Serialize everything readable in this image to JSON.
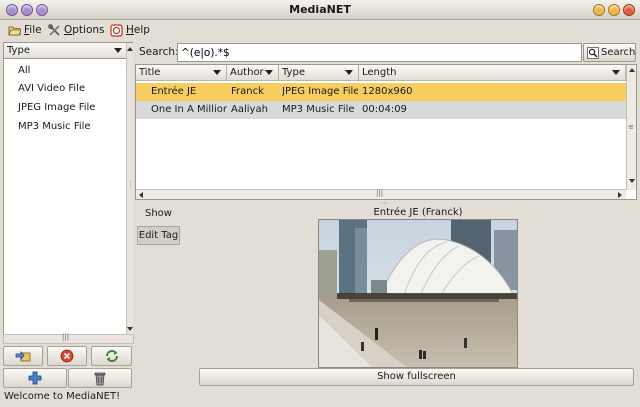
{
  "window": {
    "title": "MediaNET"
  },
  "menu": [
    {
      "label": "File",
      "icon": "open-folder-icon"
    },
    {
      "label": "Options",
      "icon": "tools-icon"
    },
    {
      "label": "Help",
      "icon": "help-icon"
    }
  ],
  "type_filter": {
    "selected": "Type",
    "items": [
      "All",
      "AVI Video File",
      "JPEG Image File",
      "MP3 Music File"
    ]
  },
  "left_toolbar": {
    "buttons": [
      "import-icon",
      "delete-icon",
      "refresh-icon",
      "add-icon",
      "trash-icon"
    ]
  },
  "search": {
    "label": "Search:",
    "value": "^(e|o).*$",
    "button_label": "Search"
  },
  "table": {
    "columns": [
      "Title",
      "Author",
      "Type",
      "Length"
    ],
    "rows": [
      [
        "Entrée JE",
        "Franck",
        "JPEG Image File",
        "1280x960"
      ],
      [
        "One In A Million",
        "Aaliyah",
        "MP3 Music File",
        "00:04:09"
      ]
    ],
    "selected_row": 0
  },
  "tabs": [
    {
      "label": "Show"
    },
    {
      "label": "Edit Tag"
    }
  ],
  "preview": {
    "title": "Entrée JE (Franck)",
    "fullscreen_label": "Show fullscreen"
  },
  "status": {
    "text": "Welcome to MediaNET!"
  },
  "colors": {
    "selection": "#f7cd60",
    "row_alt": "#d9d9d9",
    "close_button": "#e8583a",
    "maximize_button": "#f0b53e",
    "minimize_button": "#a88ed8"
  }
}
